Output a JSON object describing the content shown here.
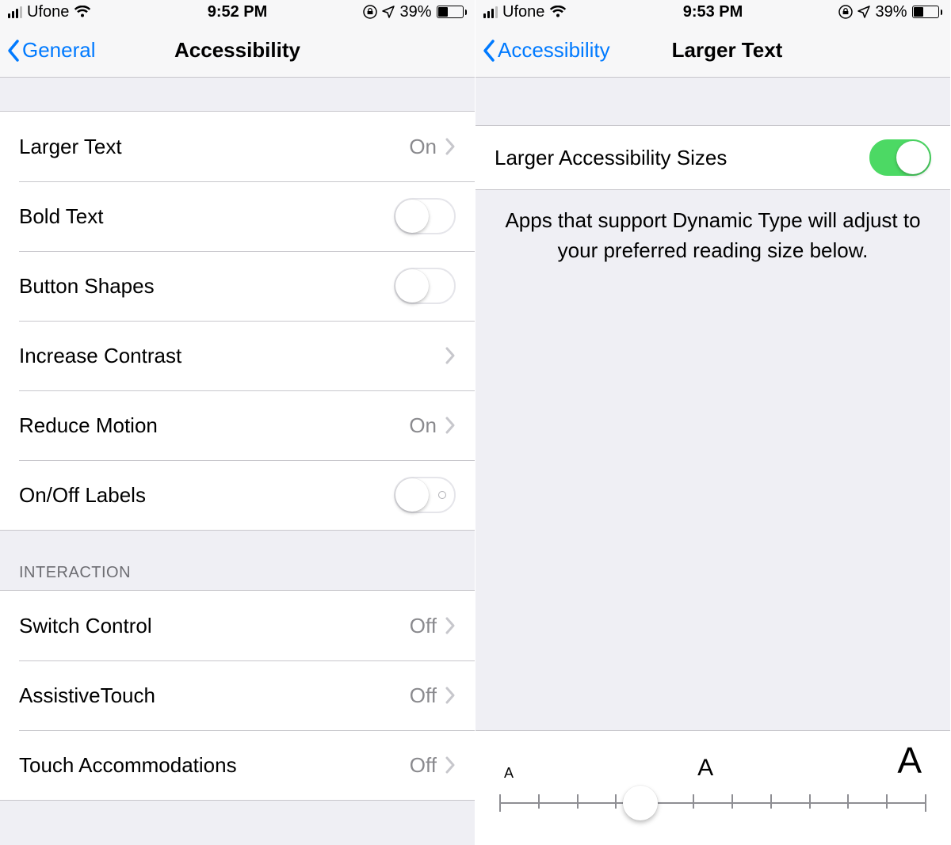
{
  "left": {
    "status": {
      "carrier": "Ufone",
      "time": "9:52 PM",
      "battery_pct": "39%"
    },
    "nav": {
      "back": "General",
      "title": "Accessibility"
    },
    "section1": {
      "larger_text": {
        "label": "Larger Text",
        "value": "On"
      },
      "bold_text": {
        "label": "Bold Text"
      },
      "button_shapes": {
        "label": "Button Shapes"
      },
      "increase_contrast": {
        "label": "Increase Contrast"
      },
      "reduce_motion": {
        "label": "Reduce Motion",
        "value": "On"
      },
      "onoff_labels": {
        "label": "On/Off Labels"
      }
    },
    "section2": {
      "header": "INTERACTION",
      "switch_control": {
        "label": "Switch Control",
        "value": "Off"
      },
      "assistive_touch": {
        "label": "AssistiveTouch",
        "value": "Off"
      },
      "touch_accommodations": {
        "label": "Touch Accommodations",
        "value": "Off"
      }
    }
  },
  "right": {
    "status": {
      "carrier": "Ufone",
      "time": "9:53 PM",
      "battery_pct": "39%"
    },
    "nav": {
      "back": "Accessibility",
      "title": "Larger Text"
    },
    "row": {
      "label": "Larger Accessibility Sizes"
    },
    "footer": "Apps that support Dynamic Type will adjust to your preferred reading size below.",
    "slider": {
      "small": "A",
      "mid": "A",
      "large": "A"
    }
  }
}
